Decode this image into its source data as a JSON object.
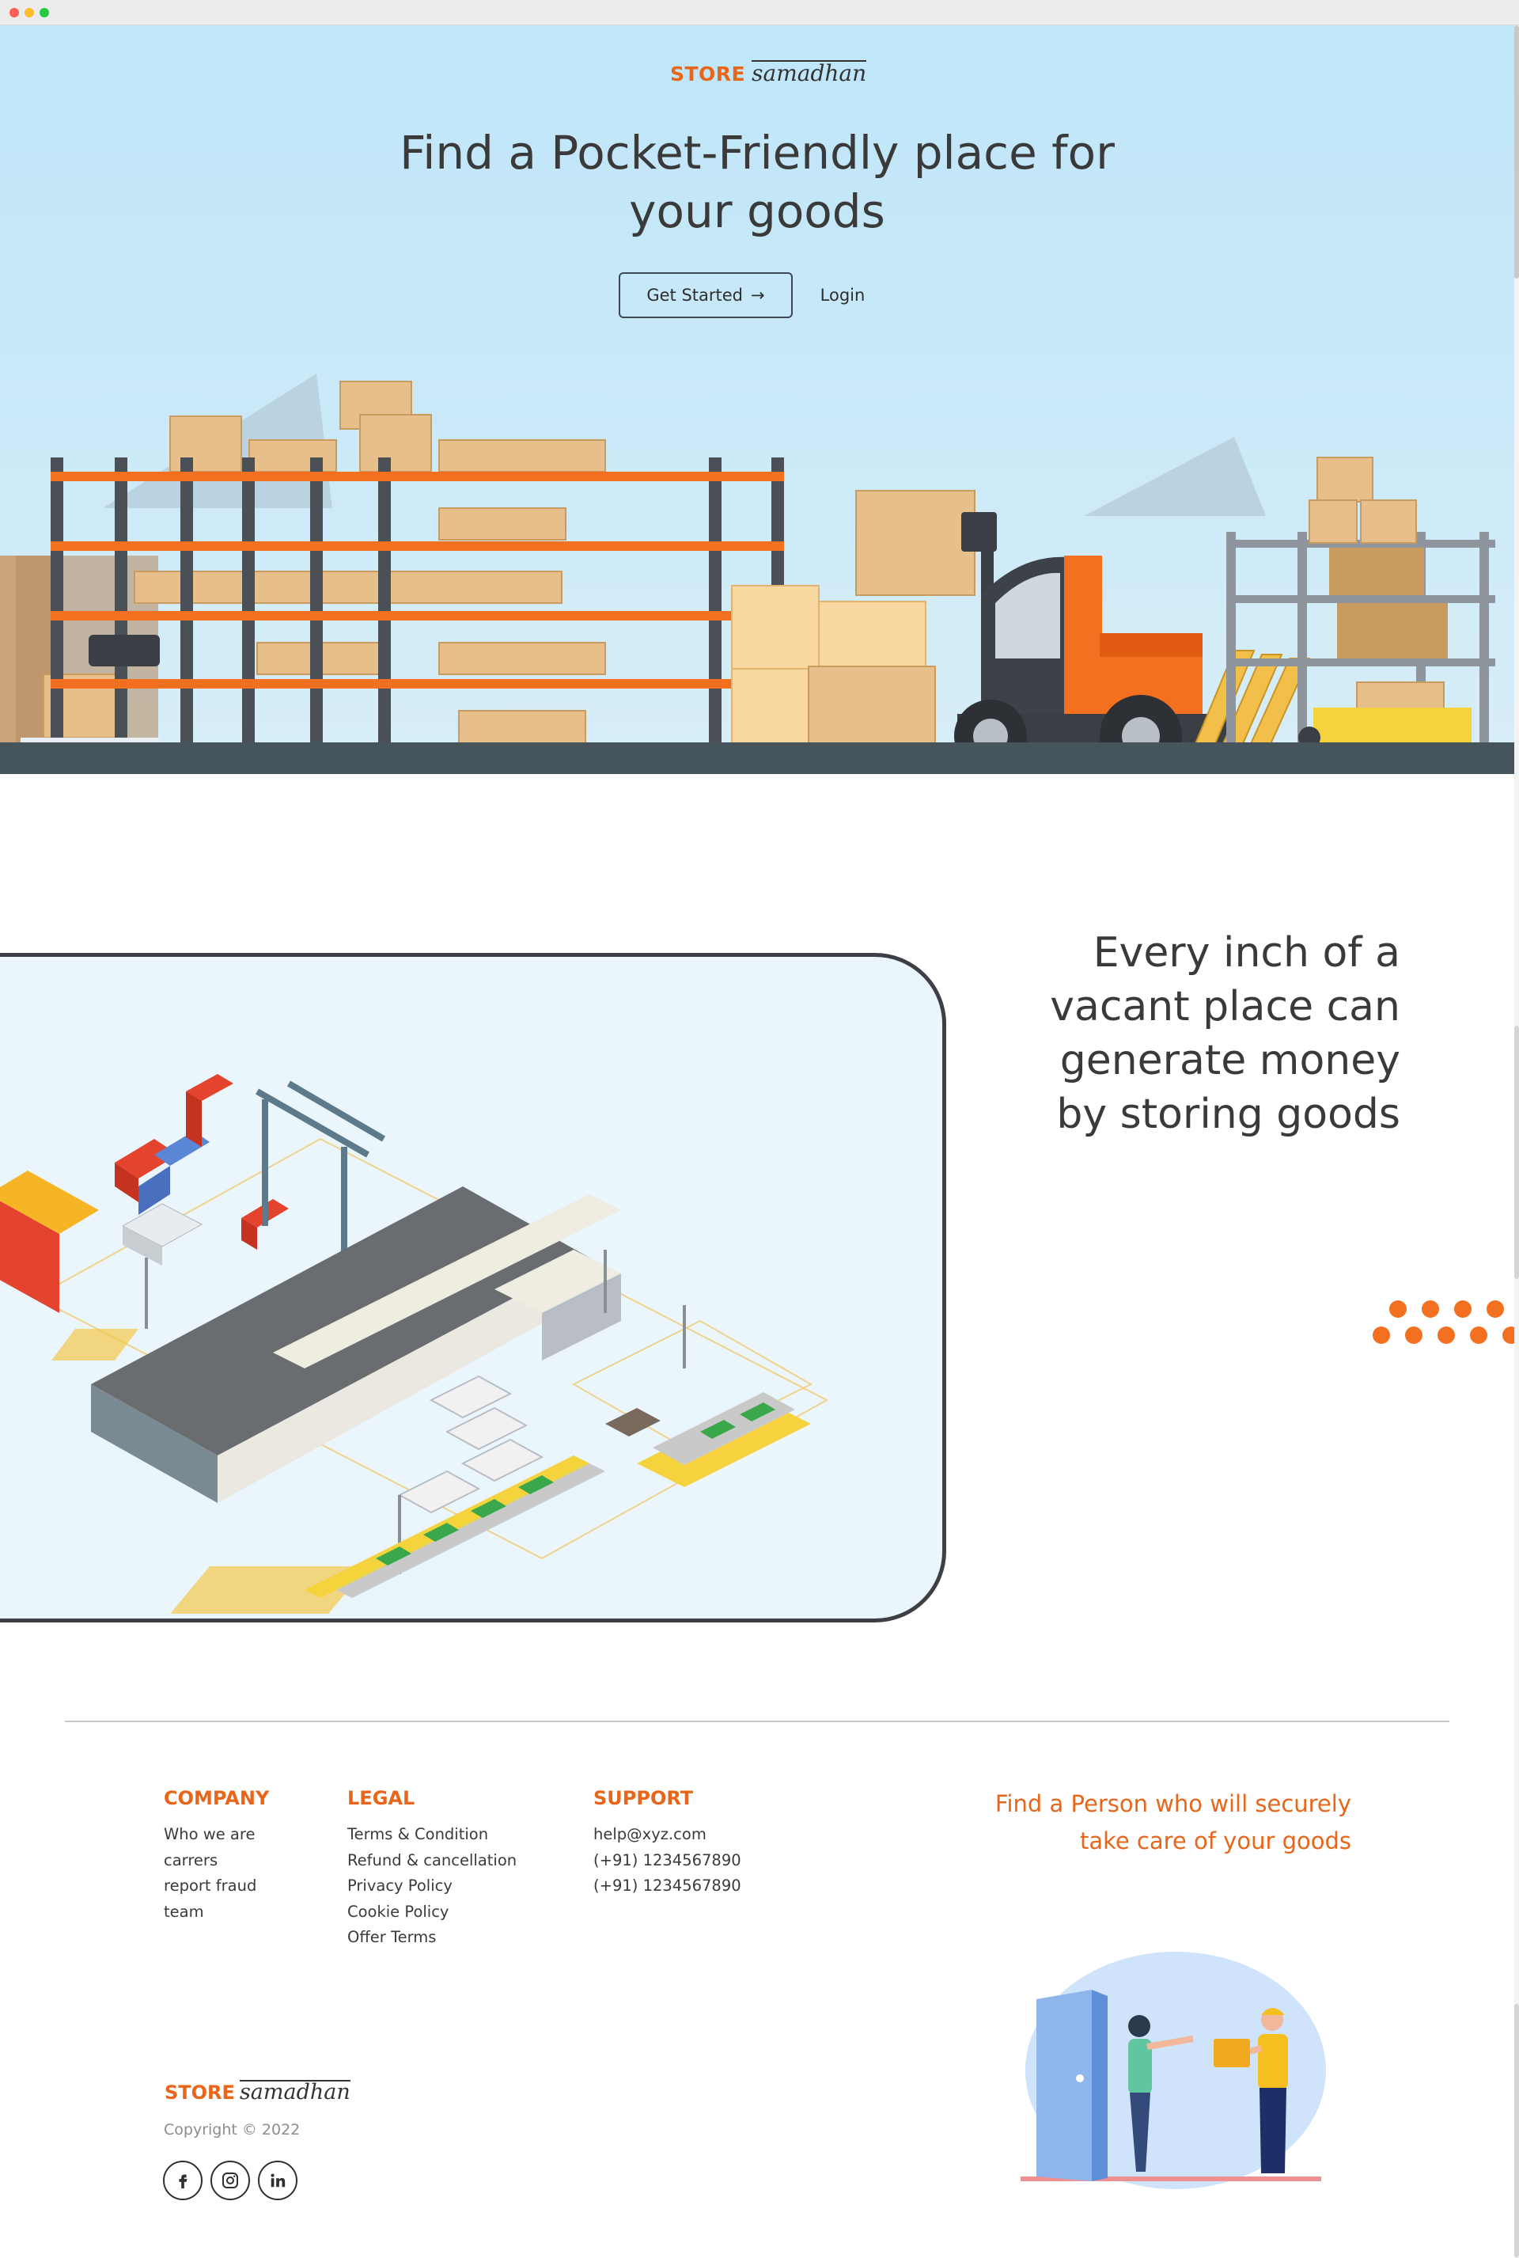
{
  "brand": {
    "store": "STORE",
    "name": "samadhan"
  },
  "hero": {
    "title_line1": "Find a Pocket-Friendly place for",
    "title_line2": "your goods",
    "get_started_label": "Get Started",
    "get_started_arrow": "→",
    "login_label": "Login"
  },
  "feature": {
    "tagline_line1": "Every inch of a",
    "tagline_line2": "vacant place can",
    "tagline_line3": "generate money",
    "tagline_line4": "by storing goods"
  },
  "footer": {
    "company": {
      "title": "COMPANY",
      "links": [
        "Who we are",
        "carrers",
        "report fraud",
        "team"
      ]
    },
    "legal": {
      "title": "LEGAL",
      "links": [
        "Terms & Condition",
        "Refund & cancellation",
        "Privacy Policy",
        "Cookie Policy",
        "Offer Terms"
      ]
    },
    "support": {
      "title": "SUPPORT",
      "links": [
        "help@xyz.com",
        "(+91) 1234567890",
        "(+91) 1234567890"
      ]
    },
    "promo_line1": "Find a Person who will securely",
    "promo_line2": "take care of your goods",
    "brand_store": "STORE",
    "brand_name": "samadhan",
    "copyright": "Copyright © 2022",
    "social_icons": [
      "facebook-icon",
      "instagram-icon",
      "linkedin-icon"
    ]
  },
  "colors": {
    "accent": "#e8661a",
    "hero_sky": "#bfe6f9",
    "text": "#3a3a3a",
    "card_border": "#3d3f44"
  }
}
